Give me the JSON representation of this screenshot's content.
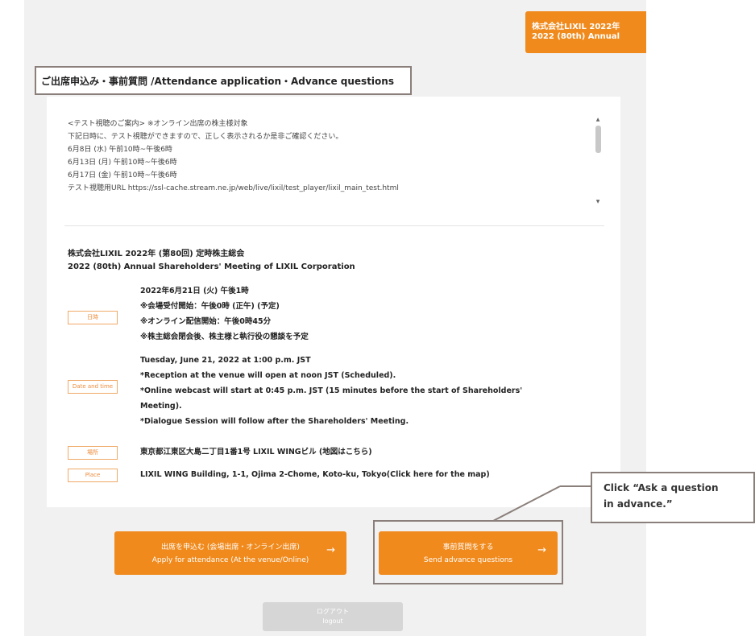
{
  "header": {
    "company_line1": "株式会社LIXIL 2022年",
    "company_line2": "2022 (80th) Annual"
  },
  "section": {
    "title": "ご出席申込み・事前質問 /Attendance application・Advance questions"
  },
  "notice": {
    "lines": [
      "<テスト視聴のご案内> ※オンライン出席の株主様対象",
      "下記日時に、テスト視聴ができますので、正しく表示されるか是非ご確認ください。",
      "6月8日 (水) 午前10時~午後6時",
      "6月13日 (月) 午前10時~午後6時",
      "6月17日 (金) 午前10時~午後6時",
      "テスト視聴用URL https://ssl-cache.stream.ne.jp/web/live/lixil/test_player/lixil_main_test.html"
    ]
  },
  "meeting": {
    "title_ja": "株式会社LIXIL 2022年 (第80回) 定時株主総会",
    "title_en": "2022 (80th) Annual Shareholders' Meeting of LIXIL Corporation"
  },
  "labels": {
    "date_ja": "日時",
    "date_en": "Date and time",
    "place_ja": "場所",
    "place_en": "Place"
  },
  "date_ja_lines": [
    "2022年6月21日 (火) 午後1時",
    "※会場受付開始：午後0時 (正午) (予定)",
    "※オンライン配信開始：午後0時45分",
    "※株主総会閉会後、株主様と執行役の懇談を予定"
  ],
  "date_en_lines": [
    "Tuesday, June 21, 2022 at 1:00 p.m. JST",
    "*Reception at the venue will open at noon JST (Scheduled).",
    "*Online webcast will start at 0:45 p.m. JST (15 minutes before the start of Shareholders'",
    "Meeting).",
    "*Dialogue Session will follow after the Shareholders' Meeting."
  ],
  "place_ja": "東京都江東区大島二丁目1番1号 LIXIL WINGビル (地図はこちら)",
  "place_en": "LIXIL WING Building, 1-1, Ojima 2-Chome, Koto-ku, Tokyo(Click here for the map)",
  "buttons": {
    "apply_ja": "出席を申込む (会場出席・オンライン出席)",
    "apply_en": "Apply for attendance (At the venue/Online)",
    "questions_ja": "事前質問をする",
    "questions_en": "Send advance questions",
    "arrow": "→"
  },
  "callout": {
    "line1": "Click “Ask a question",
    "line2": "in advance.”"
  },
  "logout": {
    "ja": "ログアウト",
    "en": "logout"
  },
  "colors": {
    "accent": "#f08a1c",
    "frame": "#8a7f7a",
    "label_border": "#f0a968"
  }
}
